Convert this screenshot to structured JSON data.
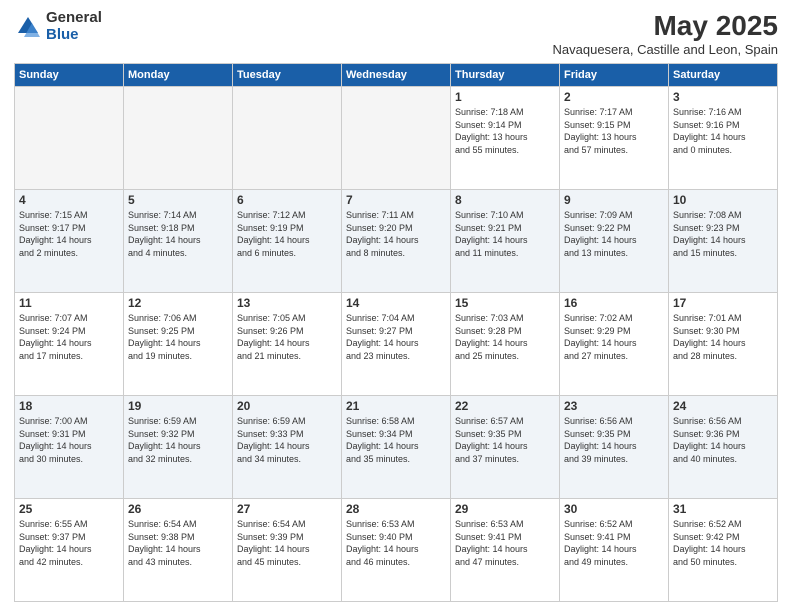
{
  "logo": {
    "general": "General",
    "blue": "Blue"
  },
  "header": {
    "title": "May 2025",
    "subtitle": "Navaquesera, Castille and Leon, Spain"
  },
  "weekdays": [
    "Sunday",
    "Monday",
    "Tuesday",
    "Wednesday",
    "Thursday",
    "Friday",
    "Saturday"
  ],
  "weeks": [
    [
      {
        "day": "",
        "info": ""
      },
      {
        "day": "",
        "info": ""
      },
      {
        "day": "",
        "info": ""
      },
      {
        "day": "",
        "info": ""
      },
      {
        "day": "1",
        "info": "Sunrise: 7:18 AM\nSunset: 9:14 PM\nDaylight: 13 hours\nand 55 minutes."
      },
      {
        "day": "2",
        "info": "Sunrise: 7:17 AM\nSunset: 9:15 PM\nDaylight: 13 hours\nand 57 minutes."
      },
      {
        "day": "3",
        "info": "Sunrise: 7:16 AM\nSunset: 9:16 PM\nDaylight: 14 hours\nand 0 minutes."
      }
    ],
    [
      {
        "day": "4",
        "info": "Sunrise: 7:15 AM\nSunset: 9:17 PM\nDaylight: 14 hours\nand 2 minutes."
      },
      {
        "day": "5",
        "info": "Sunrise: 7:14 AM\nSunset: 9:18 PM\nDaylight: 14 hours\nand 4 minutes."
      },
      {
        "day": "6",
        "info": "Sunrise: 7:12 AM\nSunset: 9:19 PM\nDaylight: 14 hours\nand 6 minutes."
      },
      {
        "day": "7",
        "info": "Sunrise: 7:11 AM\nSunset: 9:20 PM\nDaylight: 14 hours\nand 8 minutes."
      },
      {
        "day": "8",
        "info": "Sunrise: 7:10 AM\nSunset: 9:21 PM\nDaylight: 14 hours\nand 11 minutes."
      },
      {
        "day": "9",
        "info": "Sunrise: 7:09 AM\nSunset: 9:22 PM\nDaylight: 14 hours\nand 13 minutes."
      },
      {
        "day": "10",
        "info": "Sunrise: 7:08 AM\nSunset: 9:23 PM\nDaylight: 14 hours\nand 15 minutes."
      }
    ],
    [
      {
        "day": "11",
        "info": "Sunrise: 7:07 AM\nSunset: 9:24 PM\nDaylight: 14 hours\nand 17 minutes."
      },
      {
        "day": "12",
        "info": "Sunrise: 7:06 AM\nSunset: 9:25 PM\nDaylight: 14 hours\nand 19 minutes."
      },
      {
        "day": "13",
        "info": "Sunrise: 7:05 AM\nSunset: 9:26 PM\nDaylight: 14 hours\nand 21 minutes."
      },
      {
        "day": "14",
        "info": "Sunrise: 7:04 AM\nSunset: 9:27 PM\nDaylight: 14 hours\nand 23 minutes."
      },
      {
        "day": "15",
        "info": "Sunrise: 7:03 AM\nSunset: 9:28 PM\nDaylight: 14 hours\nand 25 minutes."
      },
      {
        "day": "16",
        "info": "Sunrise: 7:02 AM\nSunset: 9:29 PM\nDaylight: 14 hours\nand 27 minutes."
      },
      {
        "day": "17",
        "info": "Sunrise: 7:01 AM\nSunset: 9:30 PM\nDaylight: 14 hours\nand 28 minutes."
      }
    ],
    [
      {
        "day": "18",
        "info": "Sunrise: 7:00 AM\nSunset: 9:31 PM\nDaylight: 14 hours\nand 30 minutes."
      },
      {
        "day": "19",
        "info": "Sunrise: 6:59 AM\nSunset: 9:32 PM\nDaylight: 14 hours\nand 32 minutes."
      },
      {
        "day": "20",
        "info": "Sunrise: 6:59 AM\nSunset: 9:33 PM\nDaylight: 14 hours\nand 34 minutes."
      },
      {
        "day": "21",
        "info": "Sunrise: 6:58 AM\nSunset: 9:34 PM\nDaylight: 14 hours\nand 35 minutes."
      },
      {
        "day": "22",
        "info": "Sunrise: 6:57 AM\nSunset: 9:35 PM\nDaylight: 14 hours\nand 37 minutes."
      },
      {
        "day": "23",
        "info": "Sunrise: 6:56 AM\nSunset: 9:35 PM\nDaylight: 14 hours\nand 39 minutes."
      },
      {
        "day": "24",
        "info": "Sunrise: 6:56 AM\nSunset: 9:36 PM\nDaylight: 14 hours\nand 40 minutes."
      }
    ],
    [
      {
        "day": "25",
        "info": "Sunrise: 6:55 AM\nSunset: 9:37 PM\nDaylight: 14 hours\nand 42 minutes."
      },
      {
        "day": "26",
        "info": "Sunrise: 6:54 AM\nSunset: 9:38 PM\nDaylight: 14 hours\nand 43 minutes."
      },
      {
        "day": "27",
        "info": "Sunrise: 6:54 AM\nSunset: 9:39 PM\nDaylight: 14 hours\nand 45 minutes."
      },
      {
        "day": "28",
        "info": "Sunrise: 6:53 AM\nSunset: 9:40 PM\nDaylight: 14 hours\nand 46 minutes."
      },
      {
        "day": "29",
        "info": "Sunrise: 6:53 AM\nSunset: 9:41 PM\nDaylight: 14 hours\nand 47 minutes."
      },
      {
        "day": "30",
        "info": "Sunrise: 6:52 AM\nSunset: 9:41 PM\nDaylight: 14 hours\nand 49 minutes."
      },
      {
        "day": "31",
        "info": "Sunrise: 6:52 AM\nSunset: 9:42 PM\nDaylight: 14 hours\nand 50 minutes."
      }
    ]
  ]
}
